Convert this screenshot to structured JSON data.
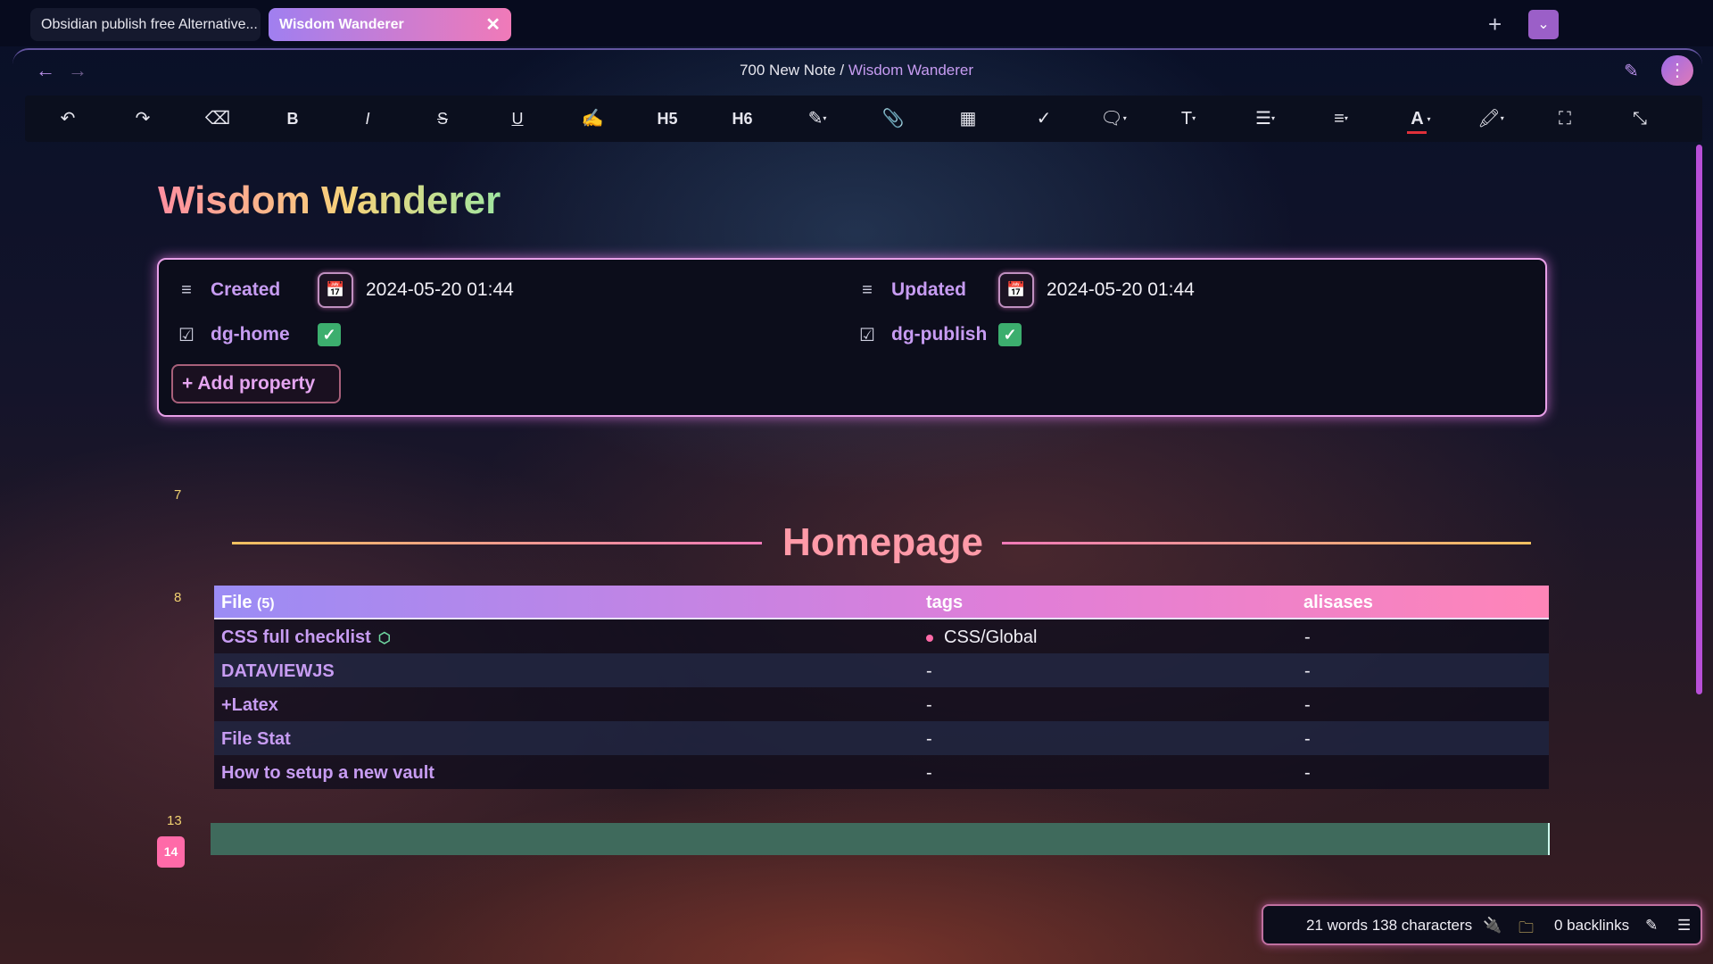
{
  "tabs": {
    "tab1_label": "Obsidian publish free Alternative...",
    "tab2_label": "Wisdom Wanderer",
    "close_glyph": "✕",
    "new_tab_glyph": "+",
    "menu_glyph": "⌄"
  },
  "nav": {
    "back_glyph": "←",
    "forward_glyph": "→",
    "breadcrumb_parent": "700 New Note",
    "breadcrumb_sep": "/",
    "breadcrumb_current": "Wisdom Wanderer",
    "edit_glyph": "✎",
    "more_glyph": "⋮"
  },
  "toolbar": {
    "undo": "↶",
    "redo": "↷",
    "eraser": "⌫",
    "bold": "B",
    "italic": "I",
    "strike": "S",
    "underline": "U",
    "brush": "✍",
    "h5": "H5",
    "h6": "H6",
    "pencil": "✎",
    "attach": "📎",
    "table": "▦",
    "check": "✓",
    "comment": "🗨",
    "textsize": "T",
    "list": "☰",
    "align": "≡",
    "fontcolor": "A",
    "highlight": "🖍",
    "fullscreen": "⛶",
    "collapse": "⤡",
    "dropdown": "▾"
  },
  "note": {
    "title": "Wisdom Wanderer",
    "properties": {
      "created_key": "Created",
      "created_value": "2024-05-20 01:44",
      "updated_key": "Updated",
      "updated_value": "2024-05-20 01:44",
      "home_key": "dg-home",
      "publish_key": "dg-publish",
      "add_property": "Add property",
      "add_glyph": "+",
      "text_glyph": "≡",
      "checkbox_glyph": "☑",
      "cal_glyph": "📅",
      "check_glyph": "✓"
    },
    "line_numbers": {
      "l7": "7",
      "l8": "8",
      "l13": "13",
      "l14": "14"
    },
    "heading": "Homepage",
    "table": {
      "col_file": "File",
      "col_file_count": "(5)",
      "col_tags": "tags",
      "col_aliases": "alisases",
      "rows": [
        {
          "file": "CSS full checklist",
          "tag": "CSS/Global",
          "alias": "-"
        },
        {
          "file": "DATAVIEWJS",
          "tag": "-",
          "alias": "-"
        },
        {
          "file": "+Latex",
          "tag": "-",
          "alias": "-"
        },
        {
          "file": "File Stat",
          "tag": "-",
          "alias": "-"
        },
        {
          "file": "How to setup a new vault",
          "tag": "-",
          "alias": "-"
        }
      ],
      "cube_glyph": "⬡"
    }
  },
  "statusbar": {
    "counts": "21 words 138 characters",
    "plug_glyph": "🔌",
    "folder_glyph": "🗀",
    "backlinks": "0 backlinks",
    "pen_glyph": "✎",
    "stack_glyph": "☰"
  },
  "colors": {
    "accent_purple": "#c79cf2",
    "accent_pink": "#ff6aa8",
    "check_green": "#3cae6e",
    "line_number_yellow": "#f0d070"
  }
}
